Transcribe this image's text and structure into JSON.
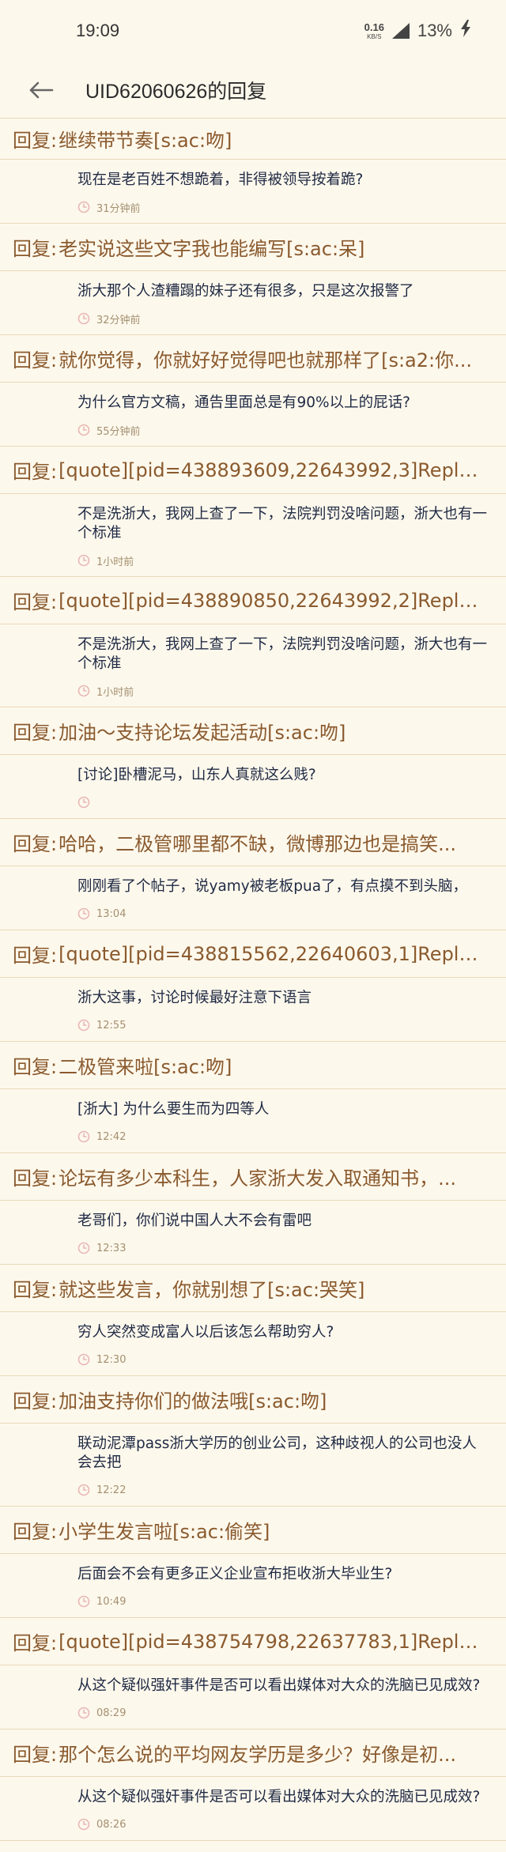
{
  "status_bar": {
    "time": "19:09",
    "net_speed_value": "0.16",
    "net_speed_unit": "KB/S",
    "network": "5G",
    "battery": "13%"
  },
  "app_bar": {
    "title": "UID62060626的回复",
    "back_icon": "arrow-left-icon"
  },
  "reply_prefix": "回复:",
  "replies": [
    {
      "subject": "继续带节奏[s:ac:吻]",
      "content": "现在是老百姓不想跪着，非得被领导按着跪?",
      "time": "31分钟前"
    },
    {
      "subject": "老实说这些文字我也能编写[s:ac:呆]",
      "content": "浙大那个人渣糟蹋的妹子还有很多，只是这次报警了",
      "time": "32分钟前"
    },
    {
      "subject": "就你觉得，你就好好觉得吧也就那样了[s:a2:你...",
      "content": "为什么官方文稿，通告里面总是有90%以上的屁话?",
      "time": "55分钟前"
    },
    {
      "subject": "[quote][pid=438893609,22643992,3]Reply[/pid]...",
      "content": "不是洗浙大，我网上查了一下，法院判罚没啥问题，浙大也有一个标准",
      "time": "1小时前"
    },
    {
      "subject": "[quote][pid=438890850,22643992,2]Reply[/pid]...",
      "content": "不是洗浙大，我网上查了一下，法院判罚没啥问题，浙大也有一个标准",
      "time": "1小时前"
    },
    {
      "subject": "加油～支持论坛发起活动[s:ac:吻]",
      "content": "[讨论]卧槽泥马，山东人真就这么贱?",
      "time": ""
    },
    {
      "subject": "哈哈，二极管哪里都不缺，微博那边也是搞笑...",
      "content": "刚刚看了个帖子，说yamy被老板pua了，有点摸不到头脑，",
      "time": "13:04"
    },
    {
      "subject": "[quote][pid=438815562,22640603,1]Reply[/pid]...",
      "content": "浙大这事，讨论时候最好注意下语言",
      "time": "12:55"
    },
    {
      "subject": "二极管来啦[s:ac:吻]",
      "content": "[浙大] 为什么要生而为四等人",
      "time": "12:42"
    },
    {
      "subject": "论坛有多少本科生，人家浙大发入取通知书，...",
      "content": "老哥们，你们说中国人大不会有雷吧",
      "time": "12:33"
    },
    {
      "subject": "就这些发言，你就别想了[s:ac:哭笑]",
      "content": "穷人突然变成富人以后该怎么帮助穷人?",
      "time": "12:30"
    },
    {
      "subject": "加油支持你们的做法哦[s:ac:吻]",
      "content": "联动泥潭pass浙大学历的创业公司，这种歧视人的公司也没人会去把",
      "time": "12:22"
    },
    {
      "subject": "小学生发言啦[s:ac:偷笑]",
      "content": "后面会不会有更多正义企业宣布拒收浙大毕业生?",
      "time": "10:49"
    },
    {
      "subject": "[quote][pid=438754798,22637783,1]Reply[/pid]...",
      "content": "从这个疑似强奸事件是否可以看出媒体对大众的洗脑已见成效?",
      "time": "08:29"
    },
    {
      "subject": "那个怎么说的平均网友学历是多少？好像是初...",
      "content": "从这个疑似强奸事件是否可以看出媒体对大众的洗脑已见成效?",
      "time": "08:26"
    },
    {
      "subject": "",
      "content": "",
      "time": ""
    }
  ]
}
